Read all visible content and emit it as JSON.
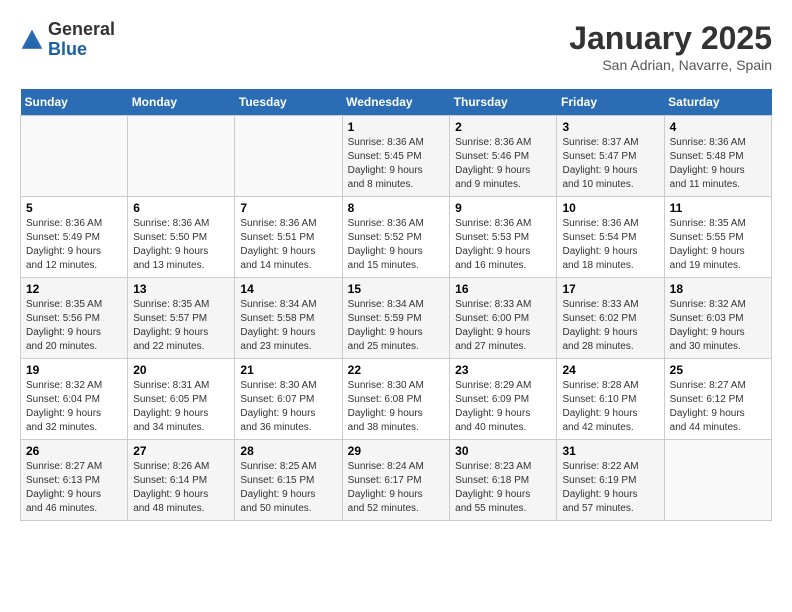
{
  "header": {
    "logo_general": "General",
    "logo_blue": "Blue",
    "month_title": "January 2025",
    "location": "San Adrian, Navarre, Spain"
  },
  "days_of_week": [
    "Sunday",
    "Monday",
    "Tuesday",
    "Wednesday",
    "Thursday",
    "Friday",
    "Saturday"
  ],
  "weeks": [
    [
      {
        "day": "",
        "info": ""
      },
      {
        "day": "",
        "info": ""
      },
      {
        "day": "",
        "info": ""
      },
      {
        "day": "1",
        "info": "Sunrise: 8:36 AM\nSunset: 5:45 PM\nDaylight: 9 hours\nand 8 minutes."
      },
      {
        "day": "2",
        "info": "Sunrise: 8:36 AM\nSunset: 5:46 PM\nDaylight: 9 hours\nand 9 minutes."
      },
      {
        "day": "3",
        "info": "Sunrise: 8:37 AM\nSunset: 5:47 PM\nDaylight: 9 hours\nand 10 minutes."
      },
      {
        "day": "4",
        "info": "Sunrise: 8:36 AM\nSunset: 5:48 PM\nDaylight: 9 hours\nand 11 minutes."
      }
    ],
    [
      {
        "day": "5",
        "info": "Sunrise: 8:36 AM\nSunset: 5:49 PM\nDaylight: 9 hours\nand 12 minutes."
      },
      {
        "day": "6",
        "info": "Sunrise: 8:36 AM\nSunset: 5:50 PM\nDaylight: 9 hours\nand 13 minutes."
      },
      {
        "day": "7",
        "info": "Sunrise: 8:36 AM\nSunset: 5:51 PM\nDaylight: 9 hours\nand 14 minutes."
      },
      {
        "day": "8",
        "info": "Sunrise: 8:36 AM\nSunset: 5:52 PM\nDaylight: 9 hours\nand 15 minutes."
      },
      {
        "day": "9",
        "info": "Sunrise: 8:36 AM\nSunset: 5:53 PM\nDaylight: 9 hours\nand 16 minutes."
      },
      {
        "day": "10",
        "info": "Sunrise: 8:36 AM\nSunset: 5:54 PM\nDaylight: 9 hours\nand 18 minutes."
      },
      {
        "day": "11",
        "info": "Sunrise: 8:35 AM\nSunset: 5:55 PM\nDaylight: 9 hours\nand 19 minutes."
      }
    ],
    [
      {
        "day": "12",
        "info": "Sunrise: 8:35 AM\nSunset: 5:56 PM\nDaylight: 9 hours\nand 20 minutes."
      },
      {
        "day": "13",
        "info": "Sunrise: 8:35 AM\nSunset: 5:57 PM\nDaylight: 9 hours\nand 22 minutes."
      },
      {
        "day": "14",
        "info": "Sunrise: 8:34 AM\nSunset: 5:58 PM\nDaylight: 9 hours\nand 23 minutes."
      },
      {
        "day": "15",
        "info": "Sunrise: 8:34 AM\nSunset: 5:59 PM\nDaylight: 9 hours\nand 25 minutes."
      },
      {
        "day": "16",
        "info": "Sunrise: 8:33 AM\nSunset: 6:00 PM\nDaylight: 9 hours\nand 27 minutes."
      },
      {
        "day": "17",
        "info": "Sunrise: 8:33 AM\nSunset: 6:02 PM\nDaylight: 9 hours\nand 28 minutes."
      },
      {
        "day": "18",
        "info": "Sunrise: 8:32 AM\nSunset: 6:03 PM\nDaylight: 9 hours\nand 30 minutes."
      }
    ],
    [
      {
        "day": "19",
        "info": "Sunrise: 8:32 AM\nSunset: 6:04 PM\nDaylight: 9 hours\nand 32 minutes."
      },
      {
        "day": "20",
        "info": "Sunrise: 8:31 AM\nSunset: 6:05 PM\nDaylight: 9 hours\nand 34 minutes."
      },
      {
        "day": "21",
        "info": "Sunrise: 8:30 AM\nSunset: 6:07 PM\nDaylight: 9 hours\nand 36 minutes."
      },
      {
        "day": "22",
        "info": "Sunrise: 8:30 AM\nSunset: 6:08 PM\nDaylight: 9 hours\nand 38 minutes."
      },
      {
        "day": "23",
        "info": "Sunrise: 8:29 AM\nSunset: 6:09 PM\nDaylight: 9 hours\nand 40 minutes."
      },
      {
        "day": "24",
        "info": "Sunrise: 8:28 AM\nSunset: 6:10 PM\nDaylight: 9 hours\nand 42 minutes."
      },
      {
        "day": "25",
        "info": "Sunrise: 8:27 AM\nSunset: 6:12 PM\nDaylight: 9 hours\nand 44 minutes."
      }
    ],
    [
      {
        "day": "26",
        "info": "Sunrise: 8:27 AM\nSunset: 6:13 PM\nDaylight: 9 hours\nand 46 minutes."
      },
      {
        "day": "27",
        "info": "Sunrise: 8:26 AM\nSunset: 6:14 PM\nDaylight: 9 hours\nand 48 minutes."
      },
      {
        "day": "28",
        "info": "Sunrise: 8:25 AM\nSunset: 6:15 PM\nDaylight: 9 hours\nand 50 minutes."
      },
      {
        "day": "29",
        "info": "Sunrise: 8:24 AM\nSunset: 6:17 PM\nDaylight: 9 hours\nand 52 minutes."
      },
      {
        "day": "30",
        "info": "Sunrise: 8:23 AM\nSunset: 6:18 PM\nDaylight: 9 hours\nand 55 minutes."
      },
      {
        "day": "31",
        "info": "Sunrise: 8:22 AM\nSunset: 6:19 PM\nDaylight: 9 hours\nand 57 minutes."
      },
      {
        "day": "",
        "info": ""
      }
    ]
  ]
}
